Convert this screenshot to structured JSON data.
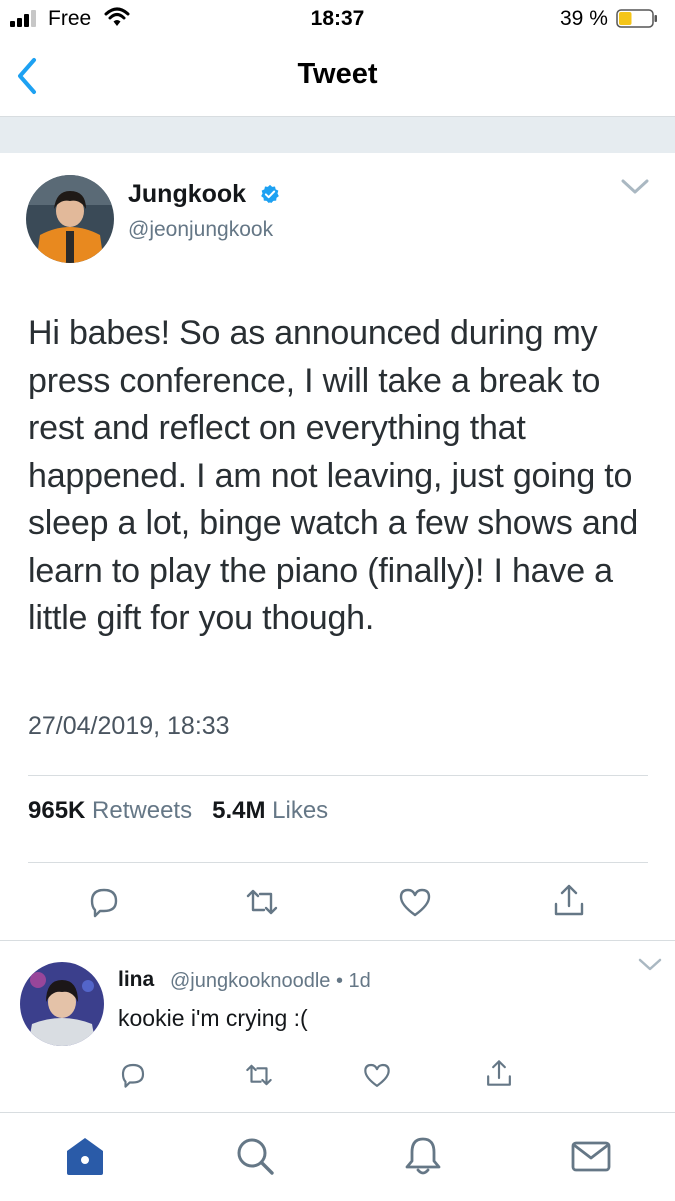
{
  "status_bar": {
    "carrier": "Free",
    "time": "18:37",
    "battery_percent": "39 %",
    "battery_level": 0.39
  },
  "nav": {
    "title": "Tweet",
    "back_icon": "chevron-left-icon"
  },
  "tweet": {
    "author_name": "Jungkook",
    "author_handle": "@jeonjungkook",
    "verified": true,
    "text": "Hi babes! So as announced during my press conference, I will take a break to rest and reflect on everything that happened. I am not leaving, just going to sleep a lot, binge watch a few shows and learn to play the piano (finally)! I have a little gift for you though.",
    "timestamp": "27/04/2019, 18:33",
    "retweets_count": "965K",
    "retweets_label": "Retweets",
    "likes_count": "5.4M",
    "likes_label": "Likes",
    "actions": [
      "reply-icon",
      "retweet-icon",
      "like-icon",
      "share-icon"
    ]
  },
  "reply": {
    "author_name": "lina",
    "meta": "@jungkooknoodle • 1d",
    "text": "kookie i'm crying :(",
    "actions": [
      "reply-icon",
      "retweet-icon",
      "like-icon",
      "share-icon"
    ]
  },
  "tab_bar": {
    "items": [
      "home-icon",
      "search-icon",
      "notifications-icon",
      "messages-icon"
    ],
    "active": "home-icon"
  },
  "colors": {
    "accent": "#1da1f2",
    "tab_active": "#2a5ba8",
    "muted": "#657786",
    "divider": "#d8dde0",
    "battery_fill": "#f5c518"
  }
}
